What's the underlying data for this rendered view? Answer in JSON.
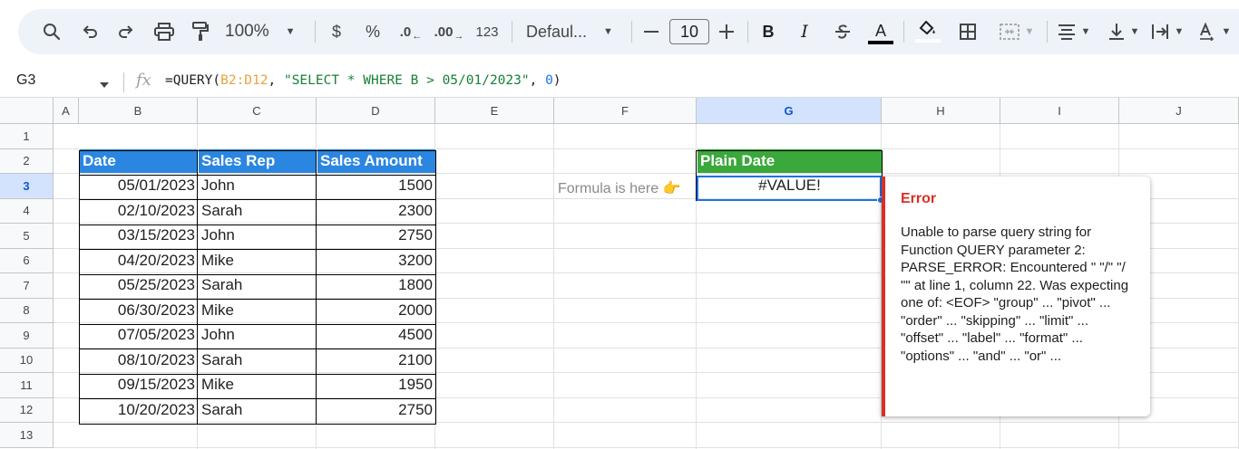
{
  "toolbar": {
    "zoom": "100%",
    "currency": "$",
    "percent": "%",
    "decrease_decimal": ".0",
    "increase_decimal": ".00",
    "number_format": "123",
    "font": "Defaul...",
    "font_size": "10",
    "bold": "B",
    "italic": "I",
    "text_color": "A"
  },
  "formula_bar": {
    "cell_ref": "G3",
    "fx": "fx",
    "formula_prefix": "=QUERY(",
    "formula_range": "B2:D12",
    "formula_comma1": ", ",
    "formula_string": "\"SELECT * WHERE B > 05/01/2023\"",
    "formula_comma2": ", ",
    "formula_number": "0",
    "formula_suffix": ")"
  },
  "columns": [
    "A",
    "B",
    "C",
    "D",
    "E",
    "F",
    "G",
    "H",
    "I",
    "J"
  ],
  "rows": [
    "1",
    "2",
    "3",
    "4",
    "5",
    "6",
    "7",
    "8",
    "9",
    "10",
    "11",
    "12",
    "13"
  ],
  "table": {
    "headers": [
      "Date",
      "Sales Rep",
      "Sales Amount"
    ],
    "rows": [
      [
        "05/01/2023",
        "John",
        "1500"
      ],
      [
        "02/10/2023",
        "Sarah",
        "2300"
      ],
      [
        "03/15/2023",
        "John",
        "2750"
      ],
      [
        "04/20/2023",
        "Mike",
        "3200"
      ],
      [
        "05/25/2023",
        "Sarah",
        "1800"
      ],
      [
        "06/30/2023",
        "Mike",
        "2000"
      ],
      [
        "07/05/2023",
        "John",
        "4500"
      ],
      [
        "08/10/2023",
        "Sarah",
        "2100"
      ],
      [
        "09/15/2023",
        "Mike",
        "1950"
      ],
      [
        "10/20/2023",
        "Sarah",
        "2750"
      ]
    ]
  },
  "output": {
    "header": "Plain Date",
    "value": "#VALUE!",
    "note": "Formula is here 👉"
  },
  "error": {
    "title": "Error",
    "message": "Unable to parse query string for Function QUERY parameter 2: PARSE_ERROR: Encountered \" \"/\" \"/ \"\" at line 1, column 22. Was expecting one of: <EOF> \"group\" ... \"pivot\" ... \"order\" ... \"skipping\" ... \"limit\" ... \"offset\" ... \"label\" ... \"format\" ... \"options\" ... \"and\" ... \"or\" ..."
  },
  "colors": {
    "header_blue": "#2a86e0",
    "header_green": "#3aa83a",
    "selection": "#1a73e8",
    "error_red": "#d93025"
  }
}
